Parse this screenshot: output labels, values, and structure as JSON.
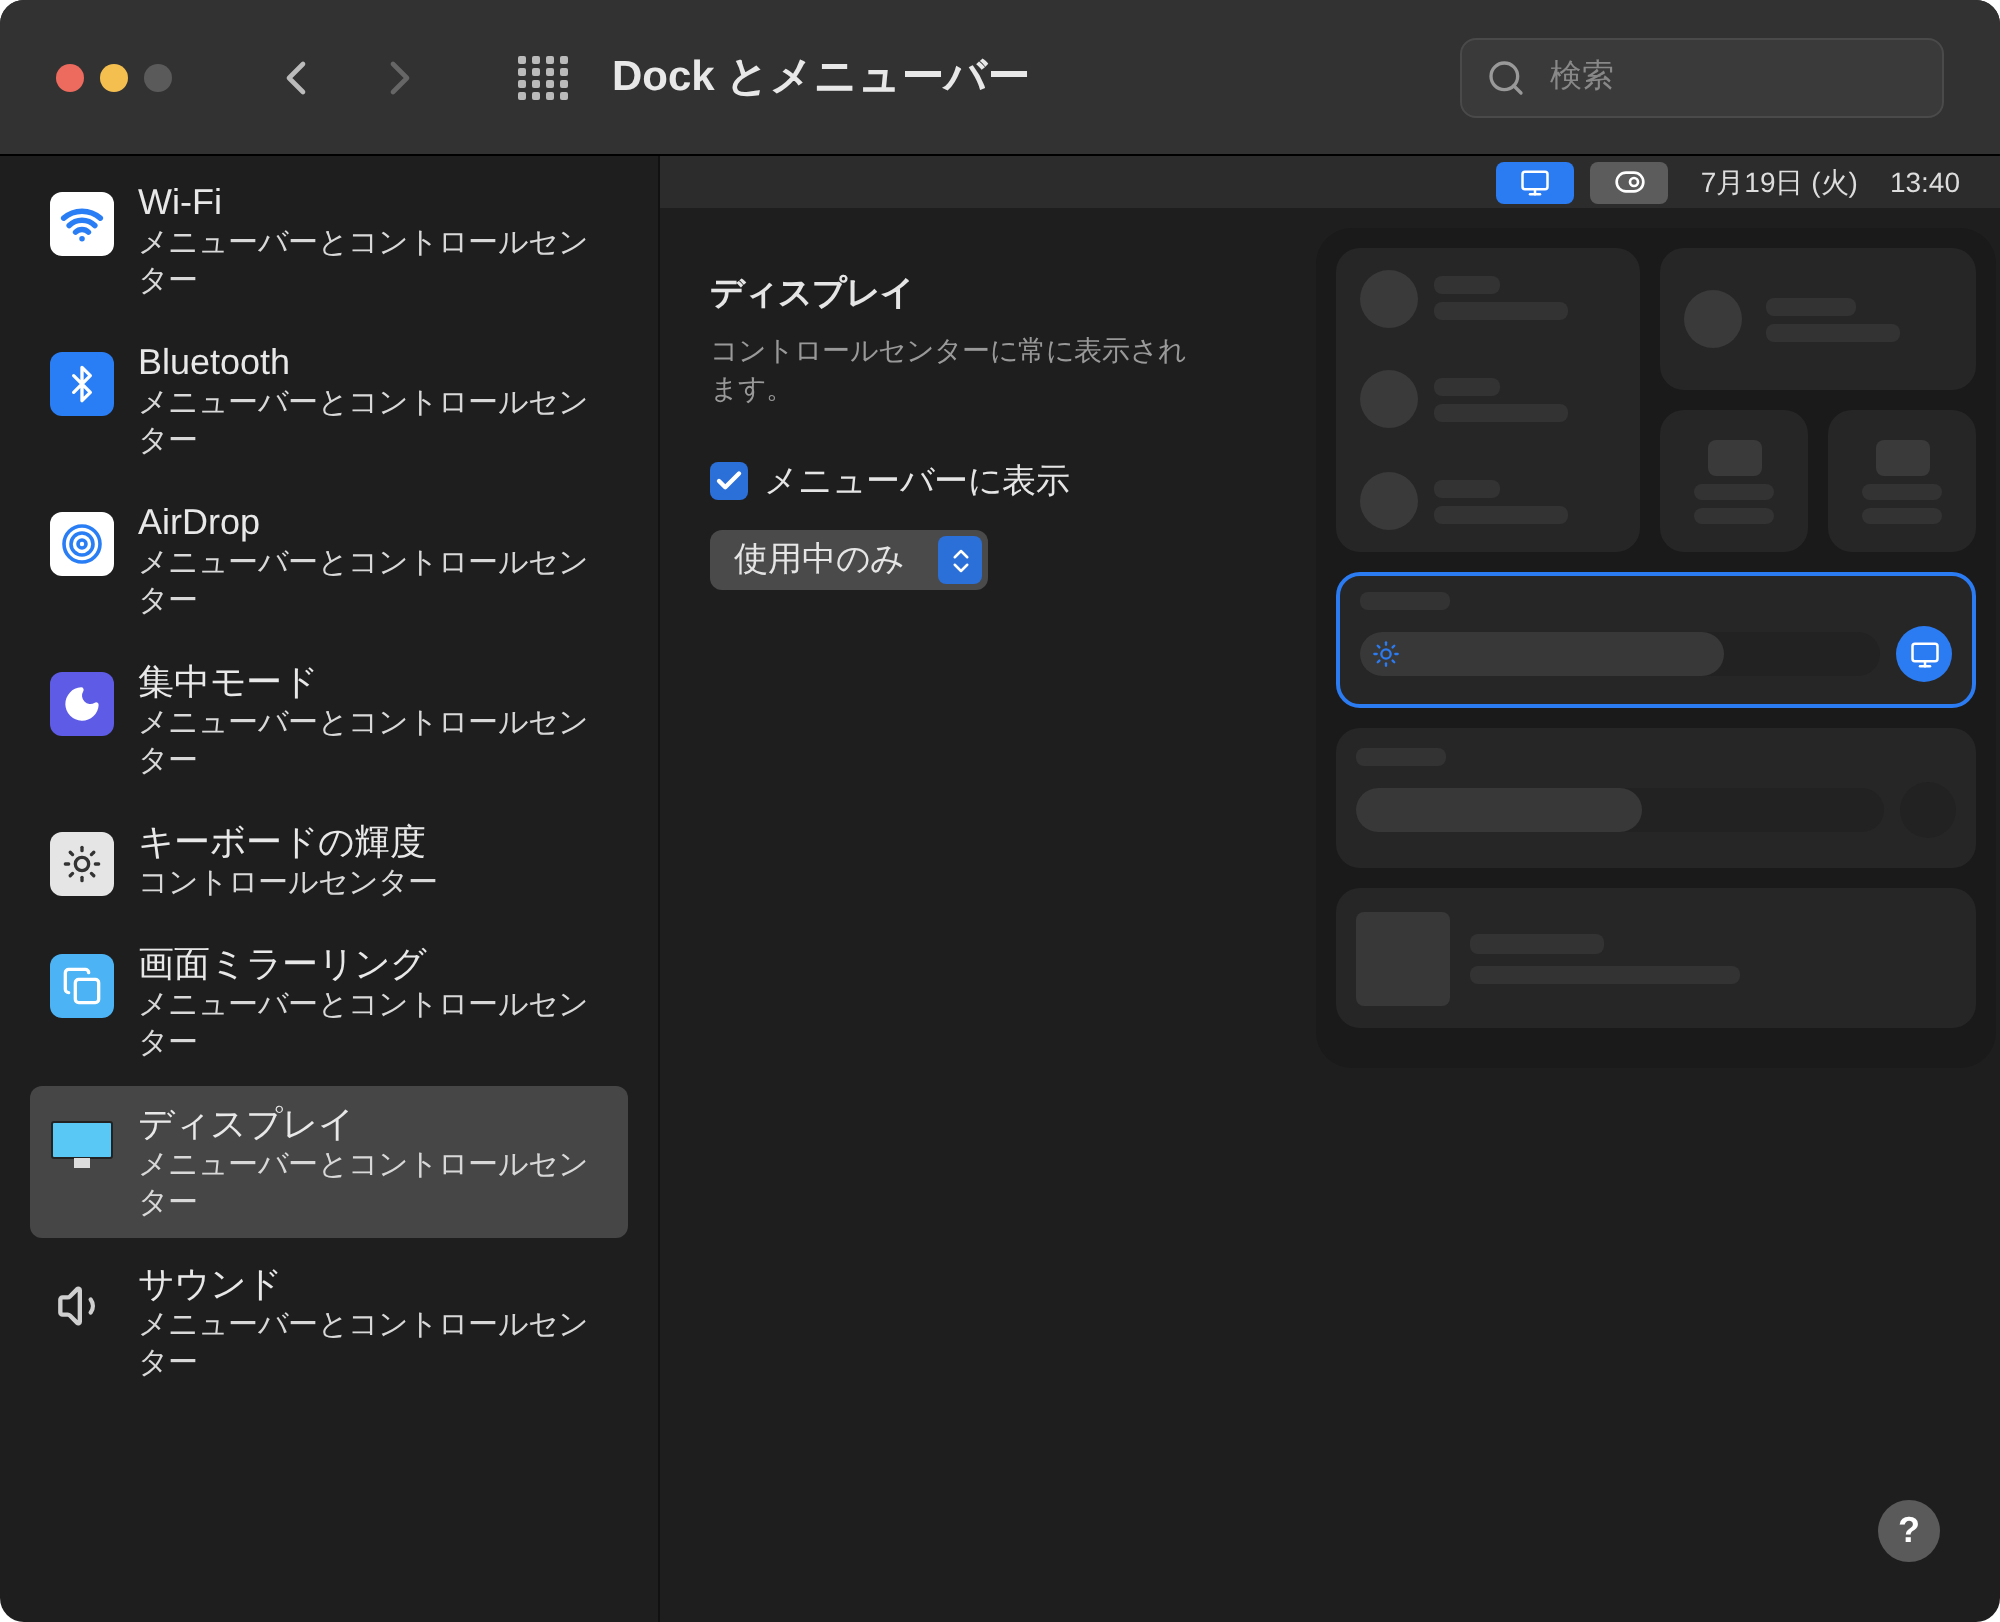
{
  "window": {
    "title": "Dock とメニューバー"
  },
  "search": {
    "placeholder": "検索"
  },
  "sidebar": {
    "items": [
      {
        "title": "Wi-Fi",
        "subtitle": "メニューバーとコントロールセンター",
        "selected": false
      },
      {
        "title": "Bluetooth",
        "subtitle": "メニューバーとコントロールセンター",
        "selected": false
      },
      {
        "title": "AirDrop",
        "subtitle": "メニューバーとコントロールセンター",
        "selected": false
      },
      {
        "title": "集中モード",
        "subtitle": "メニューバーとコントロールセンター",
        "selected": false
      },
      {
        "title": "キーボードの輝度",
        "subtitle": "コントロールセンター",
        "selected": false
      },
      {
        "title": "画面ミラーリング",
        "subtitle": "メニューバーとコントロールセンター",
        "selected": false
      },
      {
        "title": "ディスプレイ",
        "subtitle": "メニューバーとコントロールセンター",
        "selected": true
      },
      {
        "title": "サウンド",
        "subtitle": "メニューバーとコントロールセンター",
        "selected": false
      }
    ]
  },
  "menubar": {
    "buttons": [
      {
        "kind": "display",
        "selected": true
      },
      {
        "kind": "control-center",
        "selected": false
      }
    ],
    "date": "7月19日 (火)",
    "time": "13:40"
  },
  "detail": {
    "heading": "ディスプレイ",
    "description": "コントロールセンターに常に表示されます。",
    "checkbox": {
      "label": "メニューバーに表示",
      "checked": true
    },
    "popup": {
      "value": "使用中のみ"
    }
  },
  "help": {
    "label": "?"
  }
}
